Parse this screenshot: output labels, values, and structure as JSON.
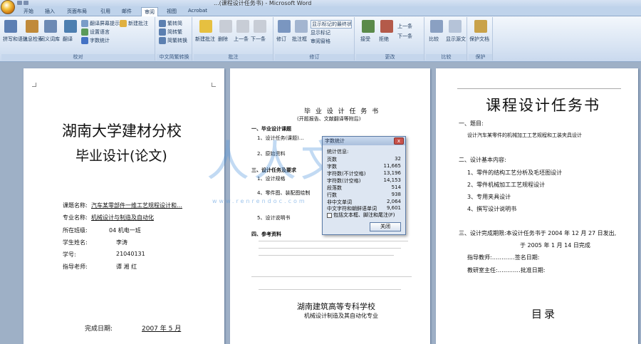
{
  "window": {
    "title": "...(课程设计任务书) - Microsoft Word"
  },
  "tabs": [
    "开始",
    "插入",
    "页面布局",
    "引用",
    "邮件",
    "审阅",
    "视图",
    "Acrobat"
  ],
  "active_tab": "审阅",
  "ribbon": {
    "groups": [
      {
        "label": "校对",
        "items": [
          "拼写和语法",
          "信息检索",
          "同义词库",
          "翻译",
          "翻译屏幕提示",
          "设置语言",
          "字数统计",
          "新建批注"
        ]
      },
      {
        "label": "中文简繁转换",
        "items": [
          "繁转简",
          "简转繁",
          "简繁转换"
        ]
      },
      {
        "label": "批注",
        "items": [
          "新建批注",
          "删除",
          "上一条",
          "下一条"
        ]
      },
      {
        "label": "修订",
        "items": [
          "修订",
          "批注框",
          "显示标记的最终状态",
          "显示标记",
          "审阅窗格"
        ]
      },
      {
        "label": "更改",
        "items": [
          "接受",
          "拒绝",
          "上一条",
          "下一条"
        ]
      },
      {
        "label": "比较",
        "items": [
          "比较",
          "显示源文档"
        ]
      },
      {
        "label": "保护",
        "items": [
          "保护文档"
        ]
      }
    ]
  },
  "page1": {
    "school": "湖南大学建材分校",
    "doc_type": "毕业设计(论文)",
    "fields": [
      {
        "label": "课题名称:",
        "value": "汽车某零部件一维工艺规程设计和…"
      },
      {
        "label": "专业名称:",
        "value": "机械设计与制造及自动化"
      },
      {
        "label": "所在班级:",
        "value": "04 机电一班"
      },
      {
        "label": "学生姓名:",
        "value": "李涛"
      },
      {
        "label": "学号:",
        "value": "21040131"
      },
      {
        "label": "指导老师:",
        "value": "谭 湘 红"
      }
    ],
    "date_label": "完成日期:",
    "date_value": "2007 年 5 月"
  },
  "page2": {
    "heading": "毕 业 设 计 任 务 书",
    "subheading": "(开题报告、文献翻译等附后)",
    "sections": [
      "一、毕业设计课题",
      "1、设计任务(课题)…",
      "2、原始资料",
      "三、设计任务及要求",
      "1、设计规格",
      "4、零件图、装配图绘制",
      "5、设计说明书",
      "四、参考资料"
    ],
    "footer1": "湖南建筑高等专科学校",
    "footer2": "机械设计制造及其自动化专业"
  },
  "page3": {
    "title": "课程设计任务书",
    "items": [
      "一、题目:",
      "设计汽车某零件的机械加工工艺规程和工装夹具设计",
      "二、设计基本内容:",
      "1、零件的结构工艺分析及毛坯图设计",
      "2、零件机械加工工艺规程设计",
      "3、专用夹具设计",
      "4、撰写设计说明书",
      "三、设计完成期限:本设计任务书于 2004 年 12 月 27 日发出,",
      "于 2005 年 1 月 14 日完成",
      "指导教师:…………签名日期:",
      "教研室主任:…………批准日期:"
    ],
    "toc": "目录"
  },
  "dialog": {
    "title": "字数统计",
    "header": "统计信息:",
    "rows": [
      {
        "label": "页数",
        "value": "32"
      },
      {
        "label": "字数",
        "value": "11,665"
      },
      {
        "label": "字符数(不计空格)",
        "value": "13,196"
      },
      {
        "label": "字符数(计空格)",
        "value": "14,153"
      },
      {
        "label": "段落数",
        "value": "514"
      },
      {
        "label": "行数",
        "value": "938"
      },
      {
        "label": "非中文单词",
        "value": "2,064"
      },
      {
        "label": "中文字符和朝鲜语单词",
        "value": "9,601"
      }
    ],
    "checkbox_label": "包括文本框、脚注和尾注(F)",
    "close_label": "关闭",
    "close_x": "x"
  },
  "watermark": {
    "text": "人人文库",
    "url": "www.renrendoc.com"
  }
}
